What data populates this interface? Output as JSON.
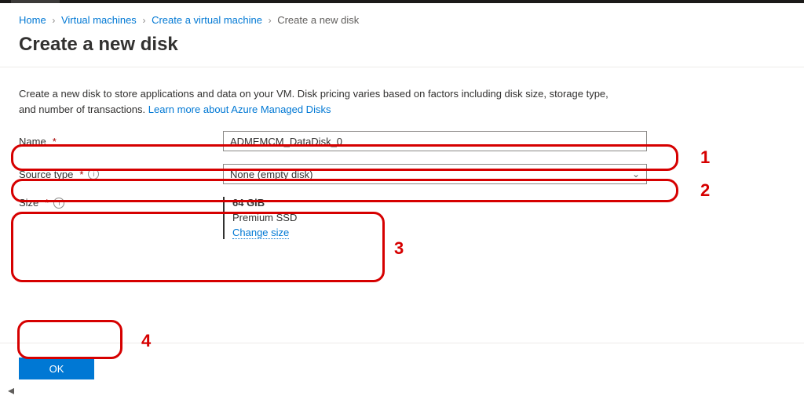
{
  "breadcrumb": {
    "home": "Home",
    "vms": "Virtual machines",
    "create_vm": "Create a virtual machine",
    "create_disk": "Create a new disk"
  },
  "page_title": "Create a new disk",
  "description": "Create a new disk to store applications and data on your VM. Disk pricing varies based on factors including disk size, storage type, and number of transactions. ",
  "learn_more": "Learn more about Azure Managed Disks",
  "fields": {
    "name": {
      "label": "Name",
      "value": "ADMEMCM_DataDisk_0"
    },
    "source_type": {
      "label": "Source type",
      "value": "None (empty disk)"
    },
    "size": {
      "label": "Size",
      "gib": "64 GiB",
      "tier": "Premium SSD",
      "change": "Change size"
    }
  },
  "buttons": {
    "ok": "OK"
  },
  "annotations": {
    "n1": "1",
    "n2": "2",
    "n3": "3",
    "n4": "4"
  }
}
